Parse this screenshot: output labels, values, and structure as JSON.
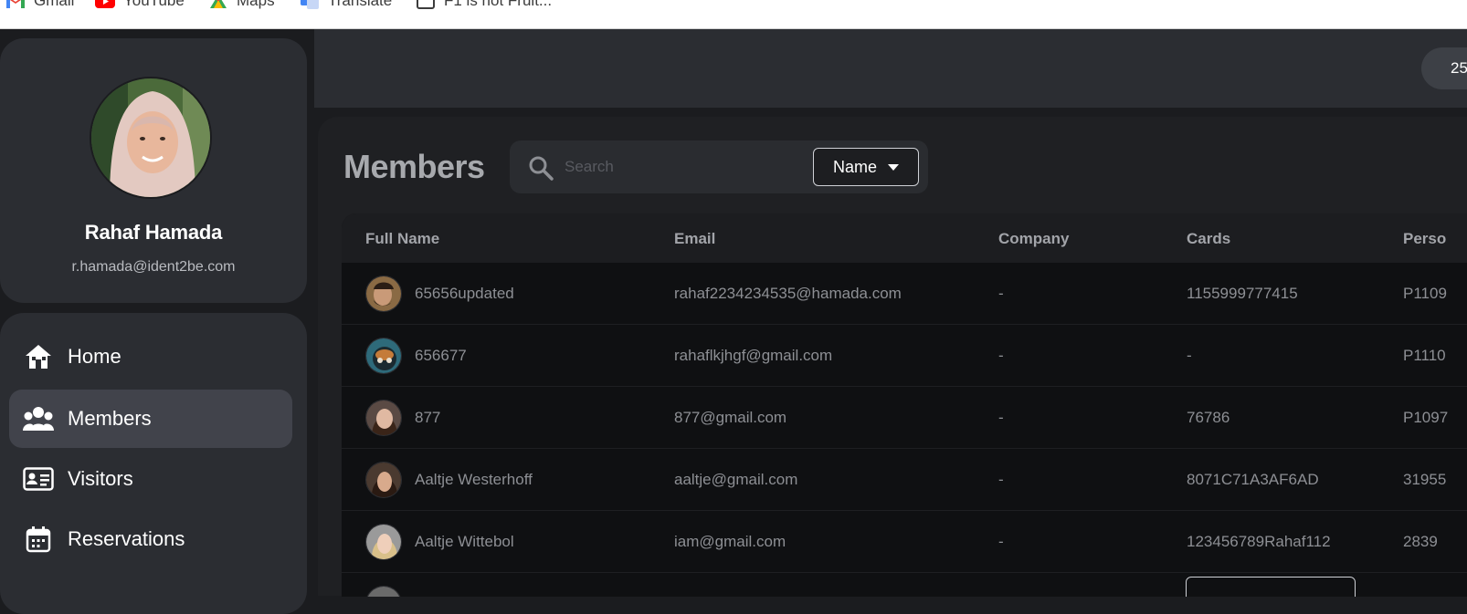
{
  "bookmarks": [
    {
      "label": "Gmail",
      "icon": "gmail-icon"
    },
    {
      "label": "YouTube",
      "icon": "youtube-icon"
    },
    {
      "label": "Maps",
      "icon": "maps-icon"
    },
    {
      "label": "Translate",
      "icon": "translate-icon"
    },
    {
      "label": "F1 is not Fruit...",
      "icon": "page-icon"
    }
  ],
  "profile": {
    "name": "Rahaf Hamada",
    "email": "r.hamada@ident2be.com"
  },
  "nav": {
    "items": [
      {
        "label": "Home",
        "icon": "home-icon",
        "active": false
      },
      {
        "label": "Members",
        "icon": "members-icon",
        "active": true
      },
      {
        "label": "Visitors",
        "icon": "id-card-icon",
        "active": false
      },
      {
        "label": "Reservations",
        "icon": "calendar-icon",
        "active": false
      }
    ]
  },
  "header": {
    "pill_text": "25"
  },
  "page": {
    "title": "Members"
  },
  "search": {
    "placeholder": "Search",
    "value": "",
    "filter_label": "Name"
  },
  "table": {
    "columns": [
      "Full Name",
      "Email",
      "Company",
      "Cards",
      "Perso"
    ],
    "rows": [
      {
        "name": "65656updated",
        "email": "rahaf2234234535@hamada.com",
        "company": "-",
        "cards": "1155999777415",
        "person": "P1109"
      },
      {
        "name": "656677",
        "email": "rahaflkjhgf@gmail.com",
        "company": "-",
        "cards": "-",
        "person": "P1110"
      },
      {
        "name": "877",
        "email": "877@gmail.com",
        "company": "-",
        "cards": "76786",
        "person": "P1097"
      },
      {
        "name": "Aaltje Westerhoff",
        "email": "aaltje@gmail.com",
        "company": "-",
        "cards": "8071C71A3AF6AD",
        "person": "31955"
      },
      {
        "name": "Aaltje Wittebol",
        "email": "iam@gmail.com",
        "company": "-",
        "cards": "123456789Rahaf112",
        "person": "2839"
      }
    ]
  },
  "colors": {
    "sidebar_card": "#2b2d32",
    "active_nav": "#41434b",
    "table_bg": "#0f1012",
    "text_muted": "#8d8f94"
  }
}
